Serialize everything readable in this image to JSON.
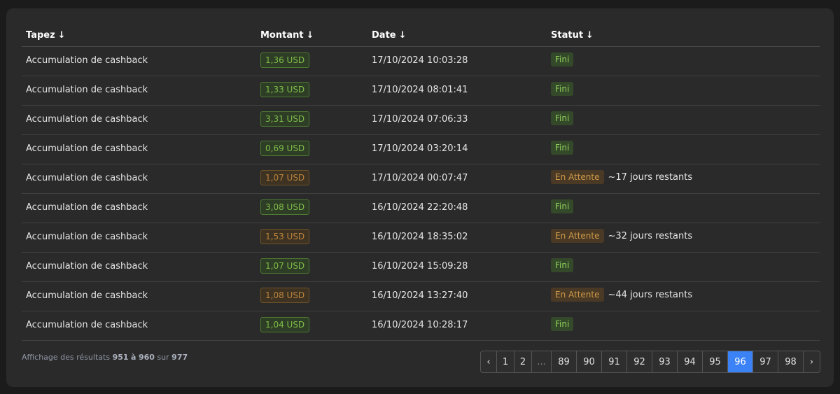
{
  "table": {
    "headers": [
      {
        "label": "Tapez",
        "arrow": "↓"
      },
      {
        "label": "Montant",
        "arrow": "↓"
      },
      {
        "label": "Date",
        "arrow": "↓"
      },
      {
        "label": "Statut",
        "arrow": "↓"
      }
    ],
    "rows": [
      {
        "type": "Accumulation de cashback",
        "amount": "1,36 USD",
        "date": "17/10/2024 10:03:28",
        "status": "Fini",
        "pending": false,
        "remaining": ""
      },
      {
        "type": "Accumulation de cashback",
        "amount": "1,33 USD",
        "date": "17/10/2024 08:01:41",
        "status": "Fini",
        "pending": false,
        "remaining": ""
      },
      {
        "type": "Accumulation de cashback",
        "amount": "3,31 USD",
        "date": "17/10/2024 07:06:33",
        "status": "Fini",
        "pending": false,
        "remaining": ""
      },
      {
        "type": "Accumulation de cashback",
        "amount": "0,69 USD",
        "date": "17/10/2024 03:20:14",
        "status": "Fini",
        "pending": false,
        "remaining": ""
      },
      {
        "type": "Accumulation de cashback",
        "amount": "1,07 USD",
        "date": "17/10/2024 00:07:47",
        "status": "En Attente",
        "pending": true,
        "remaining": "~17 jours restants"
      },
      {
        "type": "Accumulation de cashback",
        "amount": "3,08 USD",
        "date": "16/10/2024 22:20:48",
        "status": "Fini",
        "pending": false,
        "remaining": ""
      },
      {
        "type": "Accumulation de cashback",
        "amount": "1,53 USD",
        "date": "16/10/2024 18:35:02",
        "status": "En Attente",
        "pending": true,
        "remaining": "~32 jours restants"
      },
      {
        "type": "Accumulation de cashback",
        "amount": "1,07 USD",
        "date": "16/10/2024 15:09:28",
        "status": "Fini",
        "pending": false,
        "remaining": ""
      },
      {
        "type": "Accumulation de cashback",
        "amount": "1,08 USD",
        "date": "16/10/2024 13:27:40",
        "status": "En Attente",
        "pending": true,
        "remaining": "~44 jours restants"
      },
      {
        "type": "Accumulation de cashback",
        "amount": "1,04 USD",
        "date": "16/10/2024 10:28:17",
        "status": "Fini",
        "pending": false,
        "remaining": ""
      }
    ]
  },
  "summary": {
    "prefix": "Affichage des résultats",
    "from": "951",
    "mid": "à",
    "to": "960",
    "sur": "sur",
    "total": "977"
  },
  "pagination": {
    "items": [
      {
        "label": "‹",
        "kind": "prev"
      },
      {
        "label": "1"
      },
      {
        "label": "2"
      },
      {
        "label": "...",
        "kind": "dots"
      },
      {
        "label": "89"
      },
      {
        "label": "90"
      },
      {
        "label": "91"
      },
      {
        "label": "92"
      },
      {
        "label": "93"
      },
      {
        "label": "94"
      },
      {
        "label": "95"
      },
      {
        "label": "96",
        "active": true
      },
      {
        "label": "97"
      },
      {
        "label": "98"
      },
      {
        "label": "›",
        "kind": "next"
      }
    ]
  },
  "colors": {
    "accent": "#3b82f6",
    "ok": "#7fbd4a",
    "pending": "#cf9a4a"
  }
}
